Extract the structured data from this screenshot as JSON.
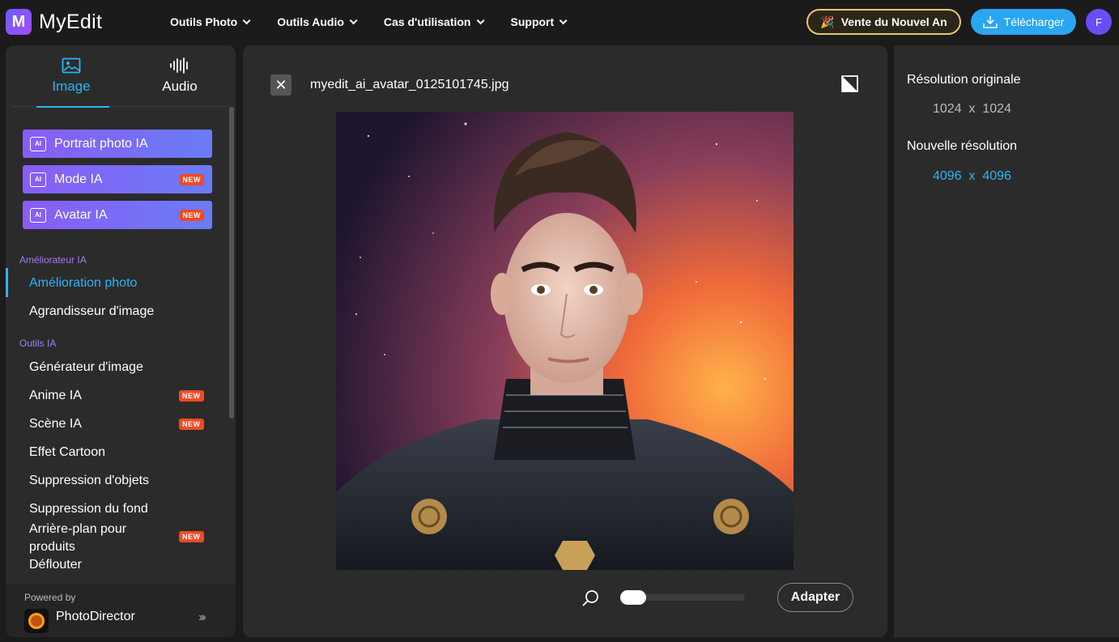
{
  "header": {
    "logo_mark": "M",
    "logo_text": "MyEdit",
    "nav": [
      "Outils Photo",
      "Outils Audio",
      "Cas d'utilisation",
      "Support"
    ],
    "sale_label": "Vente du Nouvel An",
    "download_label": "Télécharger",
    "avatar_initial": "F"
  },
  "sidebar": {
    "tabs": {
      "image": "Image",
      "audio": "Audio"
    },
    "ai_buttons": [
      {
        "label": "Portrait photo IA",
        "badge": ""
      },
      {
        "label": "Mode IA",
        "badge": "NEW"
      },
      {
        "label": "Avatar IA",
        "badge": "NEW"
      }
    ],
    "section_enhancer": "Améliorateur IA",
    "enhancer_items": [
      "Amélioration photo",
      "Agrandisseur d'image"
    ],
    "section_tools": "Outils IA",
    "tool_items": [
      {
        "label": "Générateur d'image",
        "badge": ""
      },
      {
        "label": "Anime IA",
        "badge": "NEW"
      },
      {
        "label": "Scène IA",
        "badge": "NEW"
      },
      {
        "label": "Effet Cartoon",
        "badge": ""
      },
      {
        "label": "Suppression d'objets",
        "badge": ""
      },
      {
        "label": "Suppression du fond",
        "badge": ""
      },
      {
        "label": "Arrière-plan pour produits",
        "badge": "NEW"
      },
      {
        "label": "Déflouter",
        "badge": ""
      }
    ],
    "footer": {
      "powered": "Powered by",
      "product": "PhotoDirector"
    }
  },
  "editor": {
    "filename": "myedit_ai_avatar_0125101745.jpg",
    "zoom_level": 0,
    "fit_label": "Adapter"
  },
  "resolution": {
    "original_label": "Résolution originale",
    "original_value": "1024  x  1024",
    "new_label": "Nouvelle résolution",
    "new_value": "4096  x  4096"
  },
  "colors": {
    "accent": "#2bb5f5",
    "badge": "#f04a24",
    "sale_border": "#e8c96a"
  }
}
